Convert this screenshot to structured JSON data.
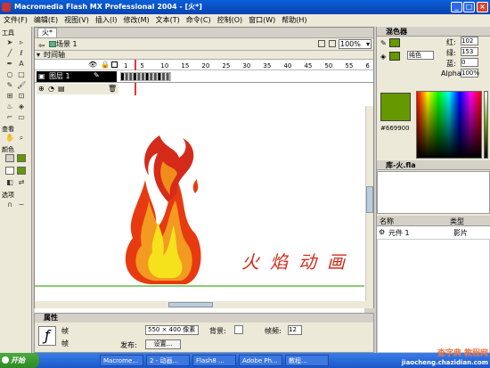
{
  "window": {
    "title": "Macromedia Flash MX Professional 2004 - [火*]"
  },
  "menu": [
    "文件(F)",
    "编辑(E)",
    "视图(V)",
    "插入(I)",
    "修改(M)",
    "文本(T)",
    "命令(C)",
    "控制(O)",
    "窗口(W)",
    "帮助(H)"
  ],
  "toolbox": {
    "tools_label": "工具",
    "view_label": "查看",
    "colors_label": "颜色",
    "options_label": "选项"
  },
  "document": {
    "tab": "火*",
    "scene": "场景 1",
    "zoom": "100%"
  },
  "timeline": {
    "label": "时间轴",
    "layer_name": "图层 1",
    "frame_numbers": [
      "1",
      "5",
      "10",
      "15",
      "20",
      "25",
      "30",
      "35",
      "40",
      "45",
      "50",
      "55",
      "60"
    ]
  },
  "stage": {
    "text": "火焰动画"
  },
  "color_mixer": {
    "title": "混色器",
    "fill_type": "纯色",
    "r_label": "红:",
    "g_label": "绿:",
    "b_label": "蓝:",
    "alpha_label": "Alpha:",
    "r": "102",
    "g": "153",
    "b": "0",
    "alpha": "100%",
    "hex": "#669900"
  },
  "library": {
    "title": "库-火.fla",
    "name_col": "名称",
    "type_col": "类型",
    "item_name": "元件 1",
    "item_type": "影片"
  },
  "properties": {
    "title": "属性",
    "type": "帧",
    "label": "帧",
    "size_label": "550 × 400 像素",
    "bg_label": "背景:",
    "fps_label": "帧频:",
    "fps": "12",
    "publish_label": "发布:",
    "settings_btn": "设置..."
  },
  "taskbar": {
    "start": "开始",
    "tasks": [
      "Macrome...",
      "2 - 动画...",
      "Flash8 ...",
      "Adobe Ph...",
      "教程..."
    ]
  },
  "watermark": {
    "line1": "查字典 教程网",
    "line2": "jiaocheng.chazidian.com"
  },
  "colors": {
    "accent": "#669900",
    "title_blue": "#0a5fd8",
    "flame_red": "#d42b1a",
    "flame_orange": "#f0901c",
    "flame_yellow": "#f6e21c"
  }
}
